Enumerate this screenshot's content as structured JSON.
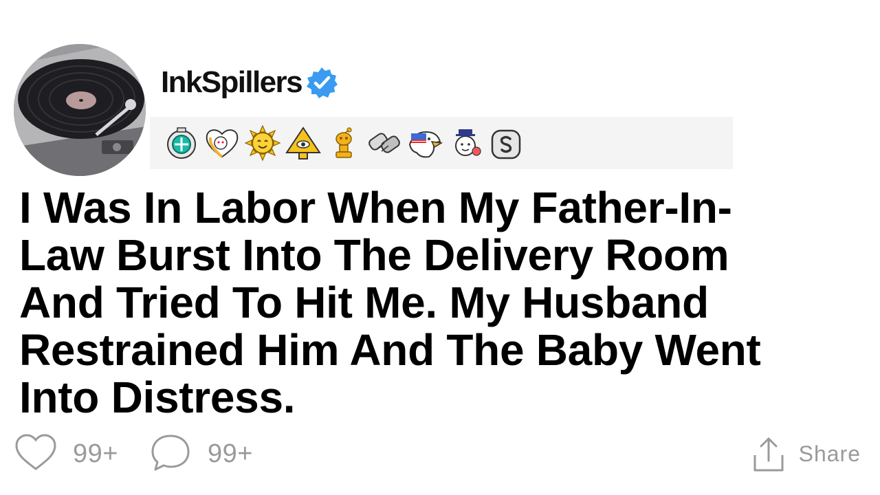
{
  "post": {
    "username": "InkSpillers",
    "verified": true,
    "title": "I Was In Labor When My Father-In-Law Burst Into The Delivery Room And Tried To Hit Me. My Husband Restrained Him And The Baby Went Into Distress.",
    "awards": [
      {
        "icon": "helpful-award-icon"
      },
      {
        "icon": "wholesome-award-icon"
      },
      {
        "icon": "sun-award-icon"
      },
      {
        "icon": "all-seeing-upvote-award-icon"
      },
      {
        "icon": "gold-award-icon"
      },
      {
        "icon": "handshake-award-icon"
      },
      {
        "icon": "eagle-award-icon"
      },
      {
        "icon": "hugz-award-icon"
      },
      {
        "icon": "silver-award-icon"
      }
    ]
  },
  "footer": {
    "likes": "99+",
    "comments": "99+",
    "share_label": "Share"
  },
  "colors": {
    "verified": "#3a9bf0",
    "muted_text": "#9a9a9a",
    "awards_bg": "#f4f4f4"
  }
}
